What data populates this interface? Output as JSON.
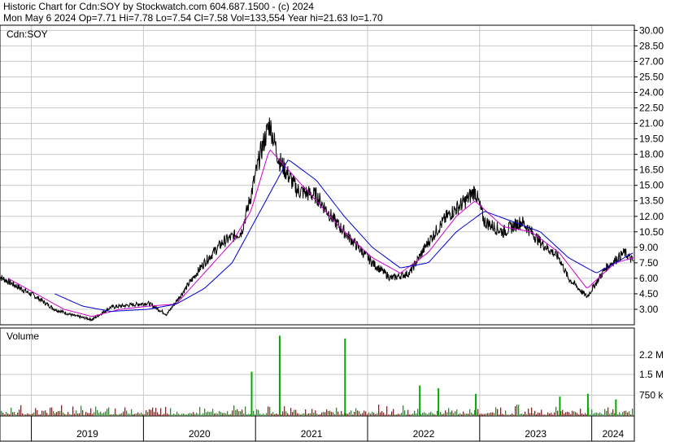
{
  "header": {
    "line1": "Historic Chart for Cdn:SOY by Stockwatch.com 604.687.1500 - (c) 2024",
    "line2": "Mon May  6 2024  Op=7.71  Hi=7.78  Lo=7.54  Cl=7.58  Vol=133,554  Year hi=21.63  lo=1.70"
  },
  "colors": {
    "price": "#000000",
    "ma_short": "#cc00cc",
    "ma_long": "#0000cc",
    "volume_up": "#00aa00",
    "volume_down": "#dd0000",
    "grid": "#c8c8c8"
  },
  "chart_data": [
    {
      "type": "line",
      "title": "Cdn:SOY",
      "x_axis_labels": [
        "2019",
        "2020",
        "2021",
        "2022",
        "2023",
        "2024"
      ],
      "ylim": [
        1.5,
        30.5
      ],
      "y_ticks": [
        3.0,
        4.5,
        6.0,
        7.5,
        9.0,
        10.5,
        12.0,
        13.5,
        15.0,
        16.5,
        18.0,
        19.5,
        21.0,
        22.5,
        24.0,
        25.5,
        27.0,
        28.5,
        30.0
      ],
      "y_tick_labels": [
        "3.00",
        "4.50",
        "6.00",
        "7.50",
        "9.00",
        "10.50",
        "12.00",
        "13.50",
        "15.00",
        "16.50",
        "18.00",
        "19.50",
        "21.00",
        "22.50",
        "24.00",
        "25.50",
        "27.00",
        "28.50",
        "30.00"
      ],
      "grid": true,
      "series": [
        {
          "role": "price",
          "points": [
            [
              "2018-09",
              6.2
            ],
            [
              "2018-11",
              5.2
            ],
            [
              "2019-01",
              4.2
            ],
            [
              "2019-03",
              3.0
            ],
            [
              "2019-05",
              2.4
            ],
            [
              "2019-07",
              2.0
            ],
            [
              "2019-09",
              3.2
            ],
            [
              "2019-11",
              3.4
            ],
            [
              "2020-01",
              3.6
            ],
            [
              "2020-03",
              2.5
            ],
            [
              "2020-05",
              5.0
            ],
            [
              "2020-07",
              7.5
            ],
            [
              "2020-09",
              9.5
            ],
            [
              "2020-11",
              10.5
            ],
            [
              "2020-12",
              14.0
            ],
            [
              "2021-01",
              18.0
            ],
            [
              "2021-02",
              21.0
            ],
            [
              "2021-03",
              17.5
            ],
            [
              "2021-05",
              14.5
            ],
            [
              "2021-07",
              14.0
            ],
            [
              "2021-09",
              11.5
            ],
            [
              "2021-11",
              9.5
            ],
            [
              "2022-01",
              7.5
            ],
            [
              "2022-03",
              6.0
            ],
            [
              "2022-05",
              6.5
            ],
            [
              "2022-07",
              9.5
            ],
            [
              "2022-09",
              12.0
            ],
            [
              "2022-11",
              13.5
            ],
            [
              "2022-12",
              14.5
            ],
            [
              "2023-01",
              11.5
            ],
            [
              "2023-03",
              10.5
            ],
            [
              "2023-05",
              11.5
            ],
            [
              "2023-07",
              9.5
            ],
            [
              "2023-09",
              8.0
            ],
            [
              "2023-10",
              6.0
            ],
            [
              "2023-12",
              4.2
            ],
            [
              "2024-02",
              7.0
            ],
            [
              "2024-04",
              8.5
            ],
            [
              "2024-05",
              7.6
            ]
          ]
        },
        {
          "role": "moving-average-short",
          "points": [
            [
              "2018-10",
              6.0
            ],
            [
              "2019-01",
              4.5
            ],
            [
              "2019-04",
              3.0
            ],
            [
              "2019-07",
              2.3
            ],
            [
              "2019-10",
              3.0
            ],
            [
              "2020-01",
              3.3
            ],
            [
              "2020-04",
              3.5
            ],
            [
              "2020-07",
              6.5
            ],
            [
              "2020-10",
              9.5
            ],
            [
              "2020-12",
              12.5
            ],
            [
              "2021-02",
              18.5
            ],
            [
              "2021-04",
              16.5
            ],
            [
              "2021-07",
              13.5
            ],
            [
              "2021-10",
              10.5
            ],
            [
              "2022-01",
              8.0
            ],
            [
              "2022-04",
              6.5
            ],
            [
              "2022-07",
              8.5
            ],
            [
              "2022-10",
              12.0
            ],
            [
              "2022-12",
              13.5
            ],
            [
              "2023-03",
              11.0
            ],
            [
              "2023-06",
              10.5
            ],
            [
              "2023-09",
              8.5
            ],
            [
              "2023-12",
              5.0
            ],
            [
              "2024-03",
              7.5
            ],
            [
              "2024-05",
              8.0
            ]
          ]
        },
        {
          "role": "moving-average-long",
          "points": [
            [
              "2019-03",
              4.5
            ],
            [
              "2019-06",
              3.3
            ],
            [
              "2019-09",
              2.8
            ],
            [
              "2020-01",
              3.0
            ],
            [
              "2020-04",
              3.5
            ],
            [
              "2020-07",
              5.0
            ],
            [
              "2020-10",
              7.5
            ],
            [
              "2021-01",
              12.5
            ],
            [
              "2021-04",
              17.5
            ],
            [
              "2021-07",
              15.5
            ],
            [
              "2021-10",
              12.0
            ],
            [
              "2022-01",
              9.0
            ],
            [
              "2022-04",
              7.0
            ],
            [
              "2022-07",
              7.5
            ],
            [
              "2022-10",
              10.5
            ],
            [
              "2023-01",
              12.5
            ],
            [
              "2023-04",
              11.5
            ],
            [
              "2023-07",
              10.5
            ],
            [
              "2023-10",
              8.0
            ],
            [
              "2024-01",
              6.5
            ],
            [
              "2024-03",
              7.5
            ],
            [
              "2024-05",
              8.5
            ]
          ]
        }
      ]
    },
    {
      "type": "bar",
      "title": "Volume",
      "ylim": [
        0,
        3000000
      ],
      "y_ticks": [
        750000,
        1500000,
        2200000
      ],
      "y_tick_labels": [
        "750 k",
        "1.5 M",
        "2.2 M"
      ],
      "grid": true,
      "spikes": [
        {
          "date": "2020-12",
          "value": 1600000
        },
        {
          "date": "2021-03",
          "value": 2900000
        },
        {
          "date": "2021-10",
          "value": 2800000
        },
        {
          "date": "2022-06",
          "value": 1100000
        },
        {
          "date": "2022-08",
          "value": 1000000
        },
        {
          "date": "2022-12",
          "value": 800000
        },
        {
          "date": "2023-09",
          "value": 700000
        },
        {
          "date": "2023-12",
          "value": 800000
        },
        {
          "date": "2024-03",
          "value": 600000
        }
      ],
      "baseline_typical": 180000
    }
  ]
}
